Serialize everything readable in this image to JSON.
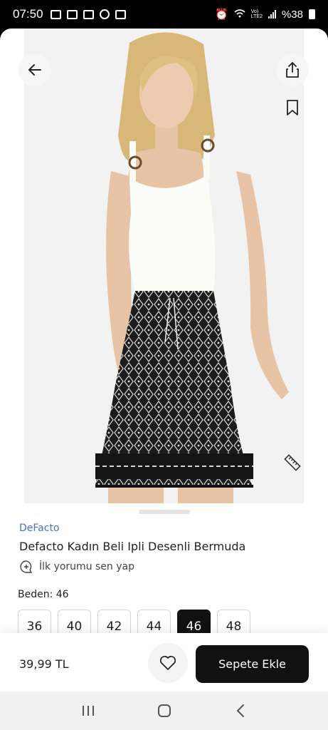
{
  "status_bar": {
    "time": "07:50",
    "network": "Vo)\nLTE2",
    "battery": "%38"
  },
  "icons": {
    "back": "arrow-left-icon",
    "share": "share-icon",
    "bookmark": "bookmark-icon",
    "size_guide": "ruler-icon",
    "review": "comment-add-icon",
    "favorite": "heart-icon"
  },
  "product": {
    "brand": "DeFacto",
    "title": "Defacto Kadın Beli Ipli Desenli Bermuda",
    "review_prompt": "İlk yorumu sen yap",
    "size_label": "Beden: 46",
    "sizes": [
      "36",
      "40",
      "42",
      "44",
      "46",
      "48"
    ],
    "selected_size": "46",
    "price": "39,99 TL",
    "add_to_cart": "Sepete Ekle"
  },
  "colors": {
    "brand_link": "#4a6fd1",
    "primary_button": "#111111",
    "selected_size": "#111111"
  }
}
